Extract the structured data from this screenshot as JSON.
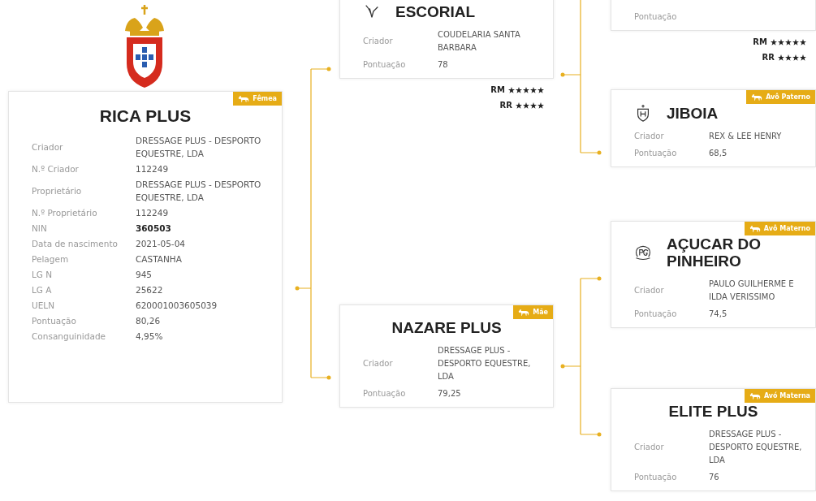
{
  "subject": {
    "name": "RICA PLUS",
    "badge": "Fêmea",
    "fields": [
      {
        "label": "Criador",
        "value": "DRESSAGE PLUS - DESPORTO EQUESTRE, LDA",
        "bold": false
      },
      {
        "label": "N.º Criador",
        "value": "112249",
        "bold": false
      },
      {
        "label": "Proprietário",
        "value": "DRESSAGE PLUS - DESPORTO EQUESTRE, LDA",
        "bold": false
      },
      {
        "label": "N.º Proprietário",
        "value": "112249",
        "bold": false
      },
      {
        "label": "NIN",
        "value": "360503",
        "bold": true
      },
      {
        "label": "Data de nascimento",
        "value": "2021-05-04",
        "bold": false
      },
      {
        "label": "Pelagem",
        "value": "CASTANHA",
        "bold": false
      },
      {
        "label": "LG N",
        "value": "945",
        "bold": false
      },
      {
        "label": "LG A",
        "value": "25622",
        "bold": false
      },
      {
        "label": "UELN",
        "value": "620001003605039",
        "bold": false
      },
      {
        "label": "Pontuação",
        "value": "80,26",
        "bold": false
      },
      {
        "label": "Consanguinidade",
        "value": "4,95%",
        "bold": false
      }
    ]
  },
  "parents": [
    {
      "name": "ESCORIAL",
      "kind": "wing",
      "fields": [
        {
          "label": "Criador",
          "value": "COUDELARIA SANTA BARBARA"
        },
        {
          "label": "Pontuação",
          "value": "78"
        }
      ],
      "ratings": [
        {
          "label": "RM",
          "stars": 5
        },
        {
          "label": "RR",
          "stars": 4
        }
      ]
    },
    {
      "name": "NAZARE PLUS",
      "badge": "Mãe",
      "fields": [
        {
          "label": "Criador",
          "value": "DRESSAGE PLUS - DESPORTO EQUESTRE, LDA"
        },
        {
          "label": "Pontuação",
          "value": "79,25"
        }
      ]
    }
  ],
  "grandparents": [
    {
      "fields": [
        {
          "label": "Pontuação"
        }
      ],
      "ratings": [
        {
          "label": "RM",
          "stars": 5
        },
        {
          "label": "RR",
          "stars": 4
        }
      ]
    },
    {
      "name": "JIBOIA",
      "badge": "Avô Paterno",
      "kind": "shield",
      "fields": [
        {
          "label": "Criador",
          "value": "REX & LEE HENRY"
        },
        {
          "label": "Pontuação",
          "value": "68,5"
        }
      ]
    },
    {
      "name": "AÇUCAR DO PINHEIRO",
      "badge": "Avô Materno",
      "kind": "pg",
      "fields": [
        {
          "label": "Criador",
          "value": "PAULO GUILHERME E ILDA VERISSIMO"
        },
        {
          "label": "Pontuação",
          "value": "74,5"
        }
      ]
    },
    {
      "name": "ELITE PLUS",
      "badge": "Avó Materna",
      "fields": [
        {
          "label": "Criador",
          "value": "DRESSAGE PLUS - DESPORTO EQUESTRE, LDA"
        },
        {
          "label": "Pontuação",
          "value": "76"
        }
      ]
    }
  ]
}
